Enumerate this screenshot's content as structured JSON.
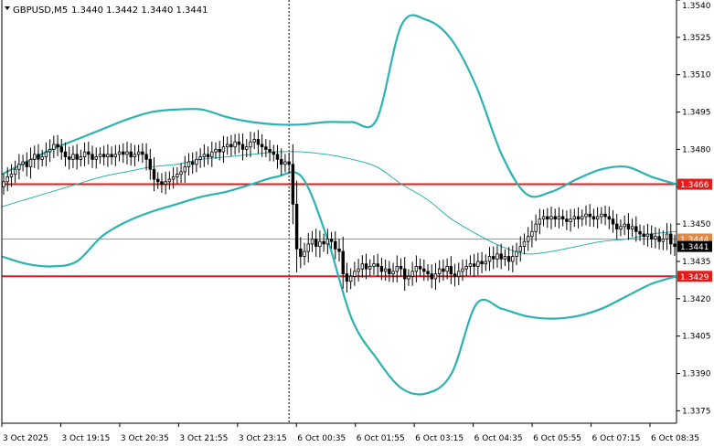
{
  "header": {
    "symbol_label": "GBPUSD,M5",
    "ohlc_label": "1.3440 1.3442 1.3440 1.3441"
  },
  "colors": {
    "background": "#ffffff",
    "axis": "#000000",
    "candle": "#000000",
    "band": "#2ab3b0",
    "midline": "#2ab3b0",
    "level": "#e31b1b",
    "current_line": "#e08a4a",
    "current_tag": "#000000"
  },
  "chart_data": {
    "type": "candlestick",
    "title": "GBPUSD,M5",
    "ylim": [
      1.337,
      1.354
    ],
    "y_ticks": [
      "1.3540",
      "1.3525",
      "1.3510",
      "1.3495",
      "1.3480",
      "1.3465",
      "1.3450",
      "1.3435",
      "1.3420",
      "1.3405",
      "1.3390",
      "1.3375"
    ],
    "x_ticks": [
      "3 Oct 2025",
      "3 Oct 19:15",
      "3 Oct 20:35",
      "3 Oct 21:55",
      "3 Oct 23:15",
      "6 Oct 00:35",
      "6 Oct 01:55",
      "6 Oct 03:15",
      "6 Oct 04:35",
      "6 Oct 05:55",
      "6 Oct 07:15",
      "6 Oct 08:35"
    ],
    "levels": [
      {
        "label": "1.3466",
        "value": 1.3466
      },
      {
        "label": "1.3429",
        "value": 1.3429
      }
    ],
    "current_line": {
      "label": "1.3444",
      "value": 1.3444
    },
    "current_price": {
      "label": "1.3441",
      "value": 1.3441
    },
    "session_separator_index": 74,
    "candle_count": 175,
    "close": [
      1.3467,
      1.3469,
      1.347,
      1.3472,
      1.3474,
      1.3475,
      1.3473,
      1.3476,
      1.3478,
      1.3476,
      1.3477,
      1.3479,
      1.348,
      1.3482,
      1.3481,
      1.3479,
      1.3477,
      1.3476,
      1.3478,
      1.3476,
      1.3477,
      1.3479,
      1.3478,
      1.3476,
      1.3477,
      1.3478,
      1.3477,
      1.3478,
      1.3477,
      1.3478,
      1.3479,
      1.3478,
      1.3479,
      1.3477,
      1.3478,
      1.3479,
      1.3478,
      1.3476,
      1.3472,
      1.3468,
      1.3467,
      1.3466,
      1.3467,
      1.3468,
      1.3469,
      1.347,
      1.3471,
      1.3473,
      1.3475,
      1.3474,
      1.3476,
      1.3477,
      1.3478,
      1.3477,
      1.3479,
      1.348,
      1.3479,
      1.3481,
      1.3482,
      1.3481,
      1.3483,
      1.3482,
      1.348,
      1.3481,
      1.3483,
      1.3484,
      1.3482,
      1.3481,
      1.348,
      1.3479,
      1.3478,
      1.3476,
      1.3474,
      1.3475,
      1.3474,
      1.3458,
      1.344,
      1.3437,
      1.3439,
      1.3442,
      1.3444,
      1.3441,
      1.3443,
      1.3442,
      1.3444,
      1.3443,
      1.344,
      1.3439,
      1.343,
      1.3427,
      1.3429,
      1.3431,
      1.3432,
      1.3434,
      1.3432,
      1.3433,
      1.3434,
      1.3433,
      1.3431,
      1.3432,
      1.343,
      1.3431,
      1.3433,
      1.3432,
      1.3428,
      1.3429,
      1.3431,
      1.3433,
      1.3432,
      1.3431,
      1.343,
      1.3428,
      1.343,
      1.3432,
      1.3431,
      1.3433,
      1.343,
      1.3429,
      1.3431,
      1.3432,
      1.3433,
      1.3434,
      1.3433,
      1.3435,
      1.3434,
      1.3435,
      1.3437,
      1.3436,
      1.3438,
      1.3436,
      1.3437,
      1.3435,
      1.3437,
      1.3439,
      1.3441,
      1.3443,
      1.3445,
      1.3447,
      1.345,
      1.3452,
      1.3453,
      1.3452,
      1.3453,
      1.3452,
      1.3453,
      1.3452,
      1.3451,
      1.3452,
      1.3453,
      1.3452,
      1.3453,
      1.3454,
      1.3453,
      1.3452,
      1.3453,
      1.3454,
      1.3453,
      1.3452,
      1.345,
      1.3448,
      1.3449,
      1.345,
      1.3448,
      1.3449,
      1.3447,
      1.3446,
      1.3445,
      1.3446,
      1.3444,
      1.3445,
      1.3443,
      1.3444,
      1.3446,
      1.3442,
      1.3441,
      1.344,
      1.3441
    ],
    "series": [
      {
        "values": [
          1.347,
          1.3475,
          1.348,
          1.3484,
          1.3488,
          1.3492,
          1.3495,
          1.3496,
          1.3496,
          1.3493,
          1.3491,
          1.349,
          1.349,
          1.3491,
          1.3491,
          1.3492,
          1.353,
          1.3532,
          1.3524,
          1.3505,
          1.3478,
          1.3462,
          1.3463,
          1.3468,
          1.3472,
          1.3473,
          1.3469,
          1.3466
        ]
      },
      {
        "values": [
          1.3457,
          1.346,
          1.3463,
          1.3466,
          1.3469,
          1.3471,
          1.3473,
          1.3474,
          1.3476,
          1.3477,
          1.3478,
          1.3479,
          1.3479,
          1.3478,
          1.3476,
          1.3473,
          1.3466,
          1.346,
          1.3452,
          1.3446,
          1.3441,
          1.3438,
          1.3439,
          1.3441,
          1.3443,
          1.3444,
          1.3446,
          1.3447
        ]
      },
      {
        "values": [
          1.3437,
          1.3434,
          1.3433,
          1.3435,
          1.3445,
          1.3451,
          1.3455,
          1.3458,
          1.3461,
          1.3463,
          1.3466,
          1.3469,
          1.3469,
          1.3445,
          1.3412,
          1.3396,
          1.3384,
          1.3382,
          1.339,
          1.3418,
          1.3416,
          1.3413,
          1.3412,
          1.3413,
          1.3416,
          1.3421,
          1.3426,
          1.3429
        ]
      }
    ]
  }
}
